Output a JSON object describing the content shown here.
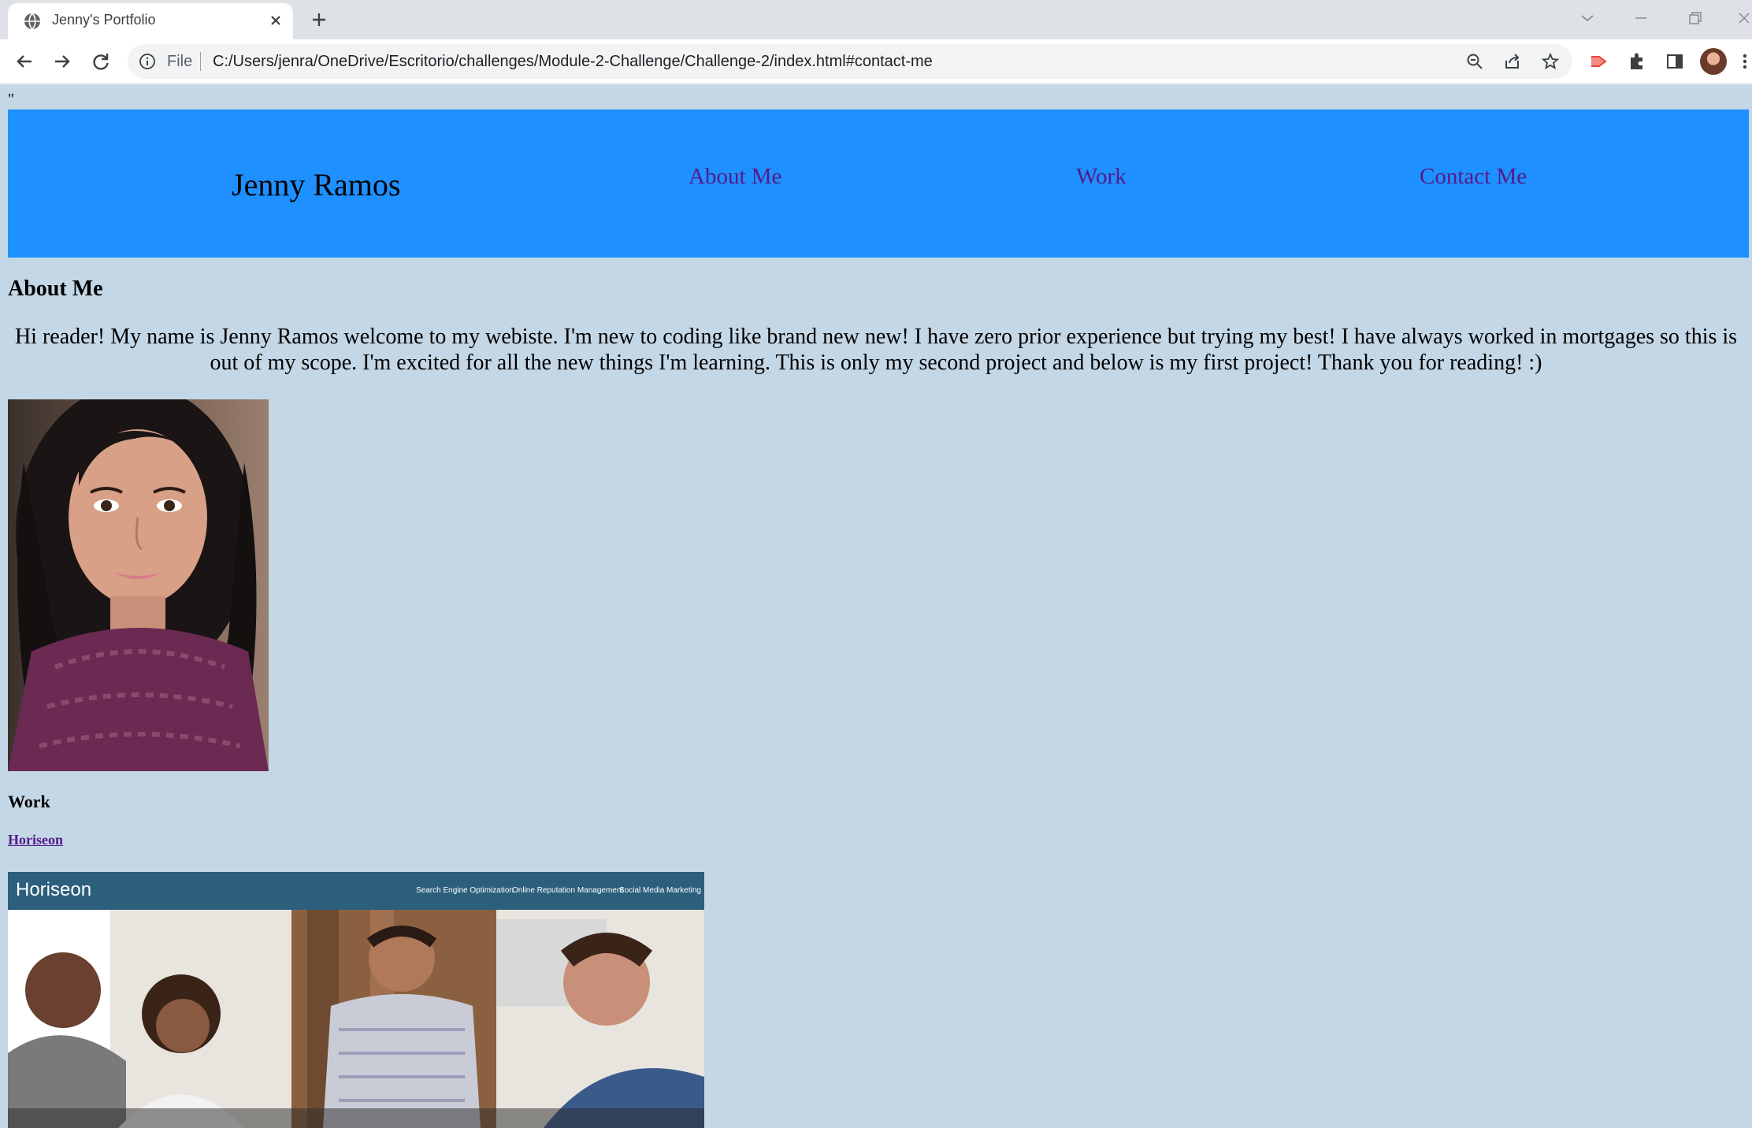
{
  "browser": {
    "tab_title": "Jenny's Portfolio",
    "file_label": "File",
    "url": "C:/Users/jenra/OneDrive/Escritorio/challenges/Module-2-Challenge/Challenge-2/index.html#contact-me",
    "icons": [
      "globe-icon",
      "close-icon",
      "plus-icon",
      "chevron-down-icon",
      "minimize-icon",
      "restore-icon",
      "window-close-icon",
      "back-icon",
      "forward-icon",
      "reload-icon",
      "info-icon",
      "zoom-icon",
      "share-icon",
      "star-icon",
      "extension-icon",
      "puzzle-icon",
      "sidepanel-icon",
      "avatar",
      "menu-icon"
    ]
  },
  "page": {
    "stray_text": "\"",
    "site_name": "Jenny Ramos",
    "nav": [
      "About Me",
      "Work",
      "Contact Me"
    ],
    "about_heading": "About Me",
    "about_text": "Hi reader! My name is Jenny Ramos welcome to my webiste. I'm new to coding like brand new new! I have zero prior experience but trying my best! I have always worked in mortgages so this is out of my scope. I'm excited for all the new things I'm learning. This is only my second project and below is my first project! Thank you for reading! :)",
    "work_heading": "Work",
    "work_link": "Horiseon",
    "screenshot": {
      "logo": "Horiseon",
      "nav": [
        "Search Engine Optimization",
        "Online Reputation Management",
        "Social Media Marketing"
      ]
    },
    "colors": {
      "background": "#c4d7e6",
      "header": "#1e90ff",
      "link": "#551a8b",
      "shot_bar": "#2c5f7c"
    }
  }
}
